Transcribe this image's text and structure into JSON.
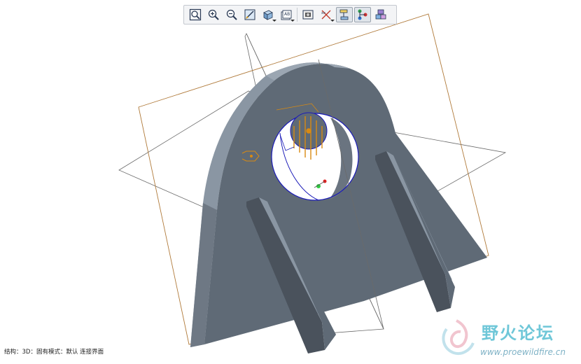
{
  "toolbar": {
    "buttons": [
      {
        "icon": "refit-icon"
      },
      {
        "icon": "zoom-in-icon"
      },
      {
        "icon": "zoom-out-icon"
      },
      {
        "icon": "repaint-icon"
      },
      {
        "icon": "display-style-icon",
        "dropdown": true
      },
      {
        "icon": "saved-views-icon",
        "dropdown": true,
        "text": "AB"
      },
      {
        "icon": "view-manager-icon"
      },
      {
        "icon": "datum-display-icon",
        "dropdown": true
      },
      {
        "icon": "component-display-icon",
        "active": true
      },
      {
        "icon": "connection-display-icon",
        "active": true
      },
      {
        "icon": "spin-center-icon"
      }
    ]
  },
  "status_bar": {
    "text": "结构：3D：固有模式：默认 连接界面"
  },
  "watermark": {
    "title": "野火论坛",
    "url": "www.proewildfire.cn"
  },
  "colors": {
    "body": "#5f6a76",
    "body_dark": "#4a525c",
    "top_light": "#8a96a3",
    "datum_plane": "#b07a3a",
    "grey_plane": "#6a6a6a",
    "hole_edge": "#1a1ab8",
    "feature_orange": "#d98a12"
  }
}
